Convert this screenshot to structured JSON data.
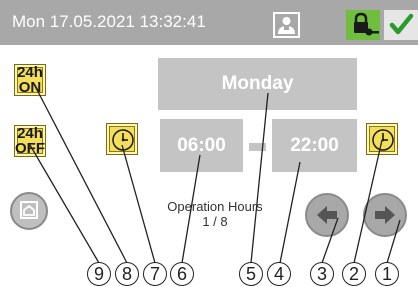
{
  "status_bar": {
    "datetime": "Mon 17.05.2021  13:32:41",
    "user_icon": "user-icon",
    "lock_icon": "key-lock-icon",
    "ok_icon": "checkmark-icon",
    "bg_color": "#a8a8a8",
    "lock_color": "#6fbe3e",
    "ok_color": "#2a9a2a"
  },
  "buttons": {
    "on_24h_top": "24h",
    "on_24h_bottom": "ON",
    "off_24h_top": "24h",
    "off_24h_bottom": "OFF"
  },
  "schedule": {
    "day": "Monday",
    "start_time": "06:00",
    "end_time": "22:00",
    "label": "Operation Hours",
    "page": "1 / 8"
  },
  "icons": {
    "start_clock": "clock-icon",
    "end_clock": "clock-icon",
    "home": "home-icon",
    "prev": "arrow-left-icon",
    "next": "arrow-right-icon"
  },
  "callouts": [
    "9",
    "8",
    "7",
    "6",
    "5",
    "4",
    "3",
    "2",
    "1"
  ],
  "colors": {
    "yellow": "#f4df5c",
    "field_grey": "#c4c4c4"
  }
}
